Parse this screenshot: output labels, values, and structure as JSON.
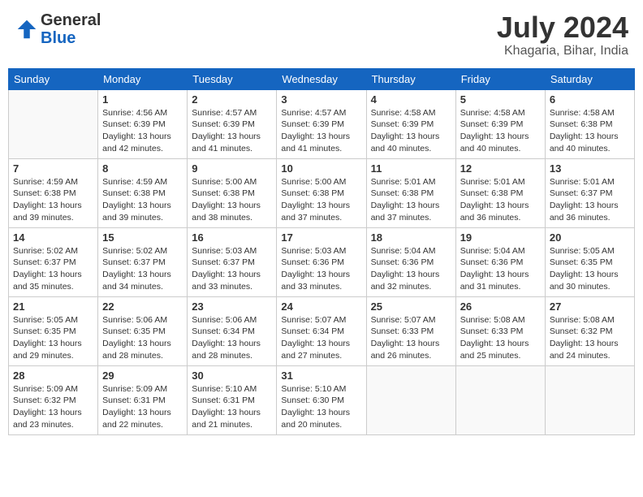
{
  "header": {
    "logo_line1": "General",
    "logo_line2": "Blue",
    "month": "July 2024",
    "location": "Khagaria, Bihar, India"
  },
  "columns": [
    "Sunday",
    "Monday",
    "Tuesday",
    "Wednesday",
    "Thursday",
    "Friday",
    "Saturday"
  ],
  "weeks": [
    [
      {
        "day": "",
        "info": ""
      },
      {
        "day": "1",
        "info": "Sunrise: 4:56 AM\nSunset: 6:39 PM\nDaylight: 13 hours\nand 42 minutes."
      },
      {
        "day": "2",
        "info": "Sunrise: 4:57 AM\nSunset: 6:39 PM\nDaylight: 13 hours\nand 41 minutes."
      },
      {
        "day": "3",
        "info": "Sunrise: 4:57 AM\nSunset: 6:39 PM\nDaylight: 13 hours\nand 41 minutes."
      },
      {
        "day": "4",
        "info": "Sunrise: 4:58 AM\nSunset: 6:39 PM\nDaylight: 13 hours\nand 40 minutes."
      },
      {
        "day": "5",
        "info": "Sunrise: 4:58 AM\nSunset: 6:39 PM\nDaylight: 13 hours\nand 40 minutes."
      },
      {
        "day": "6",
        "info": "Sunrise: 4:58 AM\nSunset: 6:38 PM\nDaylight: 13 hours\nand 40 minutes."
      }
    ],
    [
      {
        "day": "7",
        "info": "Sunrise: 4:59 AM\nSunset: 6:38 PM\nDaylight: 13 hours\nand 39 minutes."
      },
      {
        "day": "8",
        "info": "Sunrise: 4:59 AM\nSunset: 6:38 PM\nDaylight: 13 hours\nand 39 minutes."
      },
      {
        "day": "9",
        "info": "Sunrise: 5:00 AM\nSunset: 6:38 PM\nDaylight: 13 hours\nand 38 minutes."
      },
      {
        "day": "10",
        "info": "Sunrise: 5:00 AM\nSunset: 6:38 PM\nDaylight: 13 hours\nand 37 minutes."
      },
      {
        "day": "11",
        "info": "Sunrise: 5:01 AM\nSunset: 6:38 PM\nDaylight: 13 hours\nand 37 minutes."
      },
      {
        "day": "12",
        "info": "Sunrise: 5:01 AM\nSunset: 6:38 PM\nDaylight: 13 hours\nand 36 minutes."
      },
      {
        "day": "13",
        "info": "Sunrise: 5:01 AM\nSunset: 6:37 PM\nDaylight: 13 hours\nand 36 minutes."
      }
    ],
    [
      {
        "day": "14",
        "info": "Sunrise: 5:02 AM\nSunset: 6:37 PM\nDaylight: 13 hours\nand 35 minutes."
      },
      {
        "day": "15",
        "info": "Sunrise: 5:02 AM\nSunset: 6:37 PM\nDaylight: 13 hours\nand 34 minutes."
      },
      {
        "day": "16",
        "info": "Sunrise: 5:03 AM\nSunset: 6:37 PM\nDaylight: 13 hours\nand 33 minutes."
      },
      {
        "day": "17",
        "info": "Sunrise: 5:03 AM\nSunset: 6:36 PM\nDaylight: 13 hours\nand 33 minutes."
      },
      {
        "day": "18",
        "info": "Sunrise: 5:04 AM\nSunset: 6:36 PM\nDaylight: 13 hours\nand 32 minutes."
      },
      {
        "day": "19",
        "info": "Sunrise: 5:04 AM\nSunset: 6:36 PM\nDaylight: 13 hours\nand 31 minutes."
      },
      {
        "day": "20",
        "info": "Sunrise: 5:05 AM\nSunset: 6:35 PM\nDaylight: 13 hours\nand 30 minutes."
      }
    ],
    [
      {
        "day": "21",
        "info": "Sunrise: 5:05 AM\nSunset: 6:35 PM\nDaylight: 13 hours\nand 29 minutes."
      },
      {
        "day": "22",
        "info": "Sunrise: 5:06 AM\nSunset: 6:35 PM\nDaylight: 13 hours\nand 28 minutes."
      },
      {
        "day": "23",
        "info": "Sunrise: 5:06 AM\nSunset: 6:34 PM\nDaylight: 13 hours\nand 28 minutes."
      },
      {
        "day": "24",
        "info": "Sunrise: 5:07 AM\nSunset: 6:34 PM\nDaylight: 13 hours\nand 27 minutes."
      },
      {
        "day": "25",
        "info": "Sunrise: 5:07 AM\nSunset: 6:33 PM\nDaylight: 13 hours\nand 26 minutes."
      },
      {
        "day": "26",
        "info": "Sunrise: 5:08 AM\nSunset: 6:33 PM\nDaylight: 13 hours\nand 25 minutes."
      },
      {
        "day": "27",
        "info": "Sunrise: 5:08 AM\nSunset: 6:32 PM\nDaylight: 13 hours\nand 24 minutes."
      }
    ],
    [
      {
        "day": "28",
        "info": "Sunrise: 5:09 AM\nSunset: 6:32 PM\nDaylight: 13 hours\nand 23 minutes."
      },
      {
        "day": "29",
        "info": "Sunrise: 5:09 AM\nSunset: 6:31 PM\nDaylight: 13 hours\nand 22 minutes."
      },
      {
        "day": "30",
        "info": "Sunrise: 5:10 AM\nSunset: 6:31 PM\nDaylight: 13 hours\nand 21 minutes."
      },
      {
        "day": "31",
        "info": "Sunrise: 5:10 AM\nSunset: 6:30 PM\nDaylight: 13 hours\nand 20 minutes."
      },
      {
        "day": "",
        "info": ""
      },
      {
        "day": "",
        "info": ""
      },
      {
        "day": "",
        "info": ""
      }
    ]
  ]
}
